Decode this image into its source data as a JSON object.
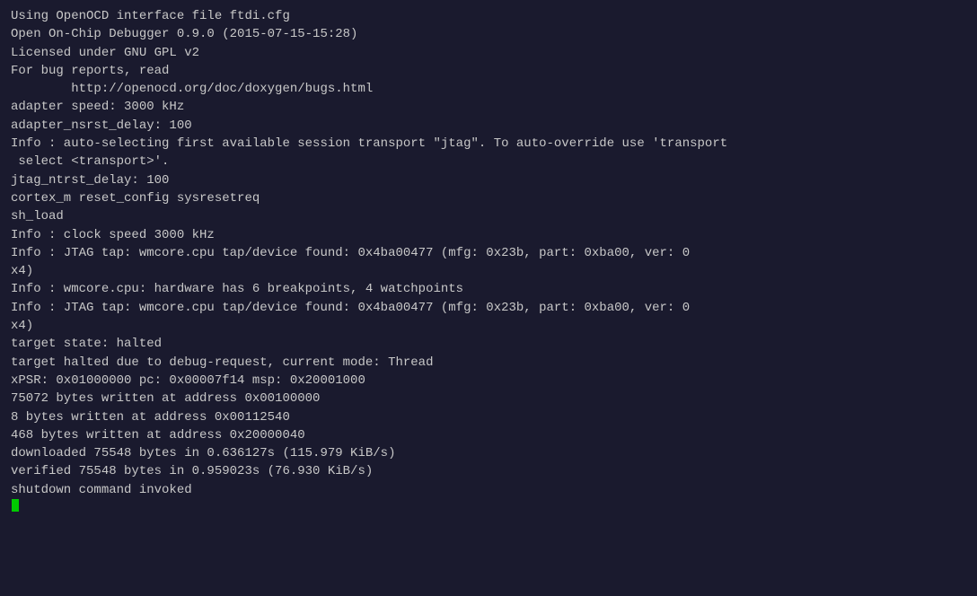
{
  "terminal": {
    "lines": [
      "Using OpenOCD interface file ftdi.cfg",
      "Open On-Chip Debugger 0.9.0 (2015-07-15-15:28)",
      "Licensed under GNU GPL v2",
      "For bug reports, read",
      "        http://openocd.org/doc/doxygen/bugs.html",
      "adapter speed: 3000 kHz",
      "adapter_nsrst_delay: 100",
      "Info : auto-selecting first available session transport \"jtag\". To auto-override use 'transport",
      " select <transport>'.",
      "jtag_ntrst_delay: 100",
      "cortex_m reset_config sysresetreq",
      "sh_load",
      "Info : clock speed 3000 kHz",
      "Info : JTAG tap: wmcore.cpu tap/device found: 0x4ba00477 (mfg: 0x23b, part: 0xba00, ver: 0",
      "x4)",
      "Info : wmcore.cpu: hardware has 6 breakpoints, 4 watchpoints",
      "Info : JTAG tap: wmcore.cpu tap/device found: 0x4ba00477 (mfg: 0x23b, part: 0xba00, ver: 0",
      "x4)",
      "target state: halted",
      "target halted due to debug-request, current mode: Thread",
      "xPSR: 0x01000000 pc: 0x00007f14 msp: 0x20001000",
      "75072 bytes written at address 0x00100000",
      "8 bytes written at address 0x00112540",
      "468 bytes written at address 0x20000040",
      "downloaded 75548 bytes in 0.636127s (115.979 KiB/s)",
      "verified 75548 bytes in 0.959023s (76.930 KiB/s)",
      "shutdown command invoked"
    ],
    "cursor_visible": true
  }
}
